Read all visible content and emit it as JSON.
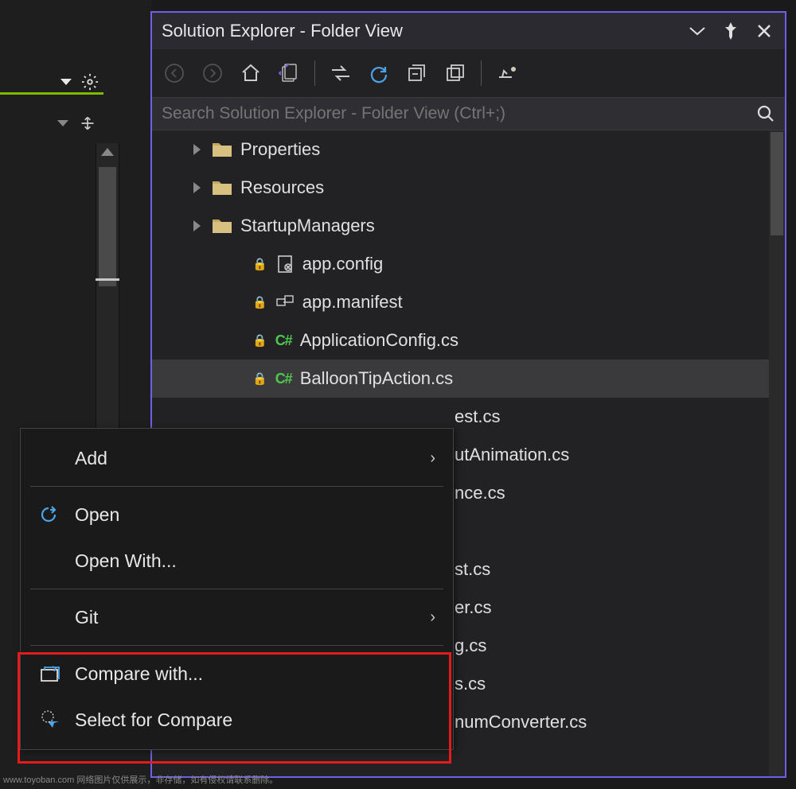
{
  "panel": {
    "title": "Solution Explorer - Folder View"
  },
  "search": {
    "placeholder": "Search Solution Explorer - Folder View (Ctrl+;)"
  },
  "tree": {
    "folders": [
      {
        "label": "Properties"
      },
      {
        "label": "Resources"
      },
      {
        "label": "StartupManagers"
      }
    ],
    "files": [
      {
        "label": "app.config",
        "kind": "config",
        "locked": true
      },
      {
        "label": "app.manifest",
        "kind": "manifest",
        "locked": true
      },
      {
        "label": "ApplicationConfig.cs",
        "kind": "cs",
        "locked": true
      },
      {
        "label": "BalloonTipAction.cs",
        "kind": "cs",
        "locked": true,
        "selected": true
      },
      {
        "label": "est.cs",
        "kind": "cs",
        "partial": true
      },
      {
        "label": "utAnimation.cs",
        "kind": "cs",
        "partial": true
      },
      {
        "label": "nce.cs",
        "kind": "cs",
        "partial": true
      },
      {
        "label": "",
        "kind": "blank"
      },
      {
        "label": "st.cs",
        "kind": "cs",
        "partial": true
      },
      {
        "label": "er.cs",
        "kind": "cs",
        "partial": true
      },
      {
        "label": "g.cs",
        "kind": "cs",
        "partial": true
      },
      {
        "label": "s.cs",
        "kind": "cs",
        "partial": true
      },
      {
        "label": "numConverter.cs",
        "kind": "cs",
        "partial": true
      }
    ]
  },
  "context_menu": {
    "items": [
      {
        "label": "Add",
        "submenu": true
      },
      {
        "label": "Open",
        "icon": "open"
      },
      {
        "label": "Open With..."
      },
      {
        "label": "Git",
        "submenu": true
      },
      {
        "label": "Compare with...",
        "icon": "compare"
      },
      {
        "label": "Select for Compare",
        "icon": "select"
      }
    ]
  },
  "watermark": "www.toyoban.com  网络图片仅供展示，非存储，如有侵权请联系删除。"
}
